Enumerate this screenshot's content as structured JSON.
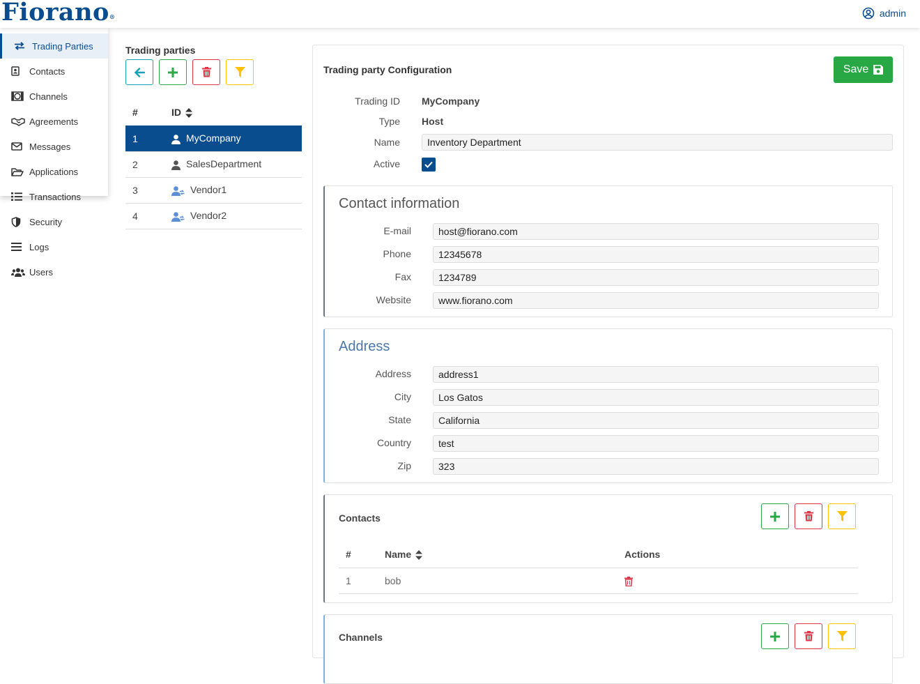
{
  "app": {
    "logo": "Fiorano",
    "user": "admin"
  },
  "sidebar": {
    "items": [
      {
        "label": "Trading Parties",
        "icon": "exchange-icon",
        "active": true
      },
      {
        "label": "Contacts",
        "icon": "contact-card-icon"
      },
      {
        "label": "Channels",
        "icon": "channels-icon"
      },
      {
        "label": "Agreements",
        "icon": "handshake-icon"
      },
      {
        "label": "Messages",
        "icon": "envelope-icon"
      },
      {
        "label": "Applications",
        "icon": "folder-open-icon"
      },
      {
        "label": "Transactions",
        "icon": "list-icon"
      },
      {
        "label": "Security",
        "icon": "shield-icon"
      },
      {
        "label": "Logs",
        "icon": "bars-icon"
      },
      {
        "label": "Users",
        "icon": "users-icon"
      }
    ]
  },
  "trading_parties": {
    "title": "Trading parties",
    "columns": {
      "num": "#",
      "id": "ID"
    },
    "rows": [
      {
        "num": "1",
        "id": "MyCompany",
        "icon": "user-icon",
        "selected": true
      },
      {
        "num": "2",
        "id": "SalesDepartment",
        "icon": "user-icon"
      },
      {
        "num": "3",
        "id": "Vendor1",
        "icon": "user-share-icon"
      },
      {
        "num": "4",
        "id": "Vendor2",
        "icon": "user-share-icon"
      }
    ]
  },
  "config": {
    "title": "Trading party Configuration",
    "save_label": "Save",
    "trading_id_label": "Trading ID",
    "trading_id": "MyCompany",
    "type_label": "Type",
    "type": "Host",
    "name_label": "Name",
    "name": "Inventory Department",
    "active_label": "Active",
    "active": true
  },
  "contact_info": {
    "title": "Contact information",
    "email_label": "E-mail",
    "email": "host@fiorano.com",
    "phone_label": "Phone",
    "phone": "12345678",
    "fax_label": "Fax",
    "fax": "1234789",
    "website_label": "Website",
    "website": "www.fiorano.com"
  },
  "address": {
    "title": "Address",
    "address_label": "Address",
    "address": "address1",
    "city_label": "City",
    "city": "Los Gatos",
    "state_label": "State",
    "state": "California",
    "country_label": "Country",
    "country": "test",
    "zip_label": "Zip",
    "zip": "323"
  },
  "contacts": {
    "title": "Contacts",
    "columns": {
      "num": "#",
      "name": "Name",
      "actions": "Actions"
    },
    "rows": [
      {
        "num": "1",
        "name": "bob"
      }
    ]
  },
  "channels": {
    "title": "Channels"
  },
  "colors": {
    "primary": "#0a4d8f",
    "success": "#28a745",
    "danger": "#dc3545",
    "warning": "#ffc107",
    "info": "#17a2b8"
  }
}
